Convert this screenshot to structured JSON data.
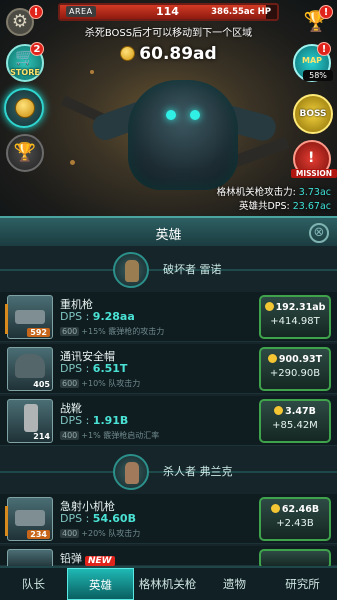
{
  "area": {
    "label": "AREA",
    "number": "114",
    "hp": "386.55ac HP",
    "hp_fraction": 0.95
  },
  "hint": "杀死BOSS后才可以移动到下一个区域",
  "gold": "60.89ad",
  "store": {
    "label": "STORE",
    "badge": "2"
  },
  "map": {
    "label": "MAP",
    "progress": "58%"
  },
  "boss": {
    "label": "BOSS"
  },
  "mission": {
    "label": "MISSION"
  },
  "alerts": {
    "top_left": "!",
    "top_right": "!"
  },
  "stats": [
    {
      "label": "格林机关枪攻击力: ",
      "value": "3.73ac"
    },
    {
      "label": "英雄共DPS: ",
      "value": "23.67ac"
    }
  ],
  "panel": {
    "title": "英雄",
    "close": "⊗"
  },
  "heroes": [
    {
      "name": "破坏者 雷诺",
      "items": [
        {
          "name": "重机枪",
          "dps_label": "DPS : ",
          "dps": "9.28aa",
          "level": "592",
          "bonus_tag": "600",
          "bonus": "+15% 霰弹枪的攻击力",
          "cost": "192.31ab",
          "gain": "+414.98T",
          "orange": true
        },
        {
          "name": "通讯安全帽",
          "dps_label": "DPS : ",
          "dps": "6.51T",
          "level": "405",
          "bonus_tag": "600",
          "bonus": "+10% 队攻击力",
          "cost": "900.93T",
          "gain": "+290.90B",
          "orange": false
        },
        {
          "name": "战靴",
          "dps_label": "DPS : ",
          "dps": "1.91B",
          "level": "214",
          "bonus_tag": "400",
          "bonus": "+1% 霰弹枪启动汇率",
          "cost": "3.47B",
          "gain": "+85.42M",
          "orange": false
        }
      ]
    },
    {
      "name": "杀人者 弗兰克",
      "items": [
        {
          "name": "急射小机枪",
          "dps_label": "DPS : ",
          "dps": "54.60B",
          "level": "234",
          "bonus_tag": "400",
          "bonus": "+20% 队攻击力",
          "cost": "62.46B",
          "gain": "+2.43B",
          "orange": true
        },
        {
          "name": "铅弹",
          "dps_label": "",
          "dps": "",
          "level": "",
          "bonus_tag": "",
          "bonus": "",
          "cost": "",
          "gain": "",
          "orange": false
        }
      ]
    }
  ],
  "tabs": {
    "new_badge": "NEW",
    "items": [
      "队长",
      "英雄",
      "格林机关枪",
      "遗物",
      "研究所"
    ],
    "active": 1
  }
}
